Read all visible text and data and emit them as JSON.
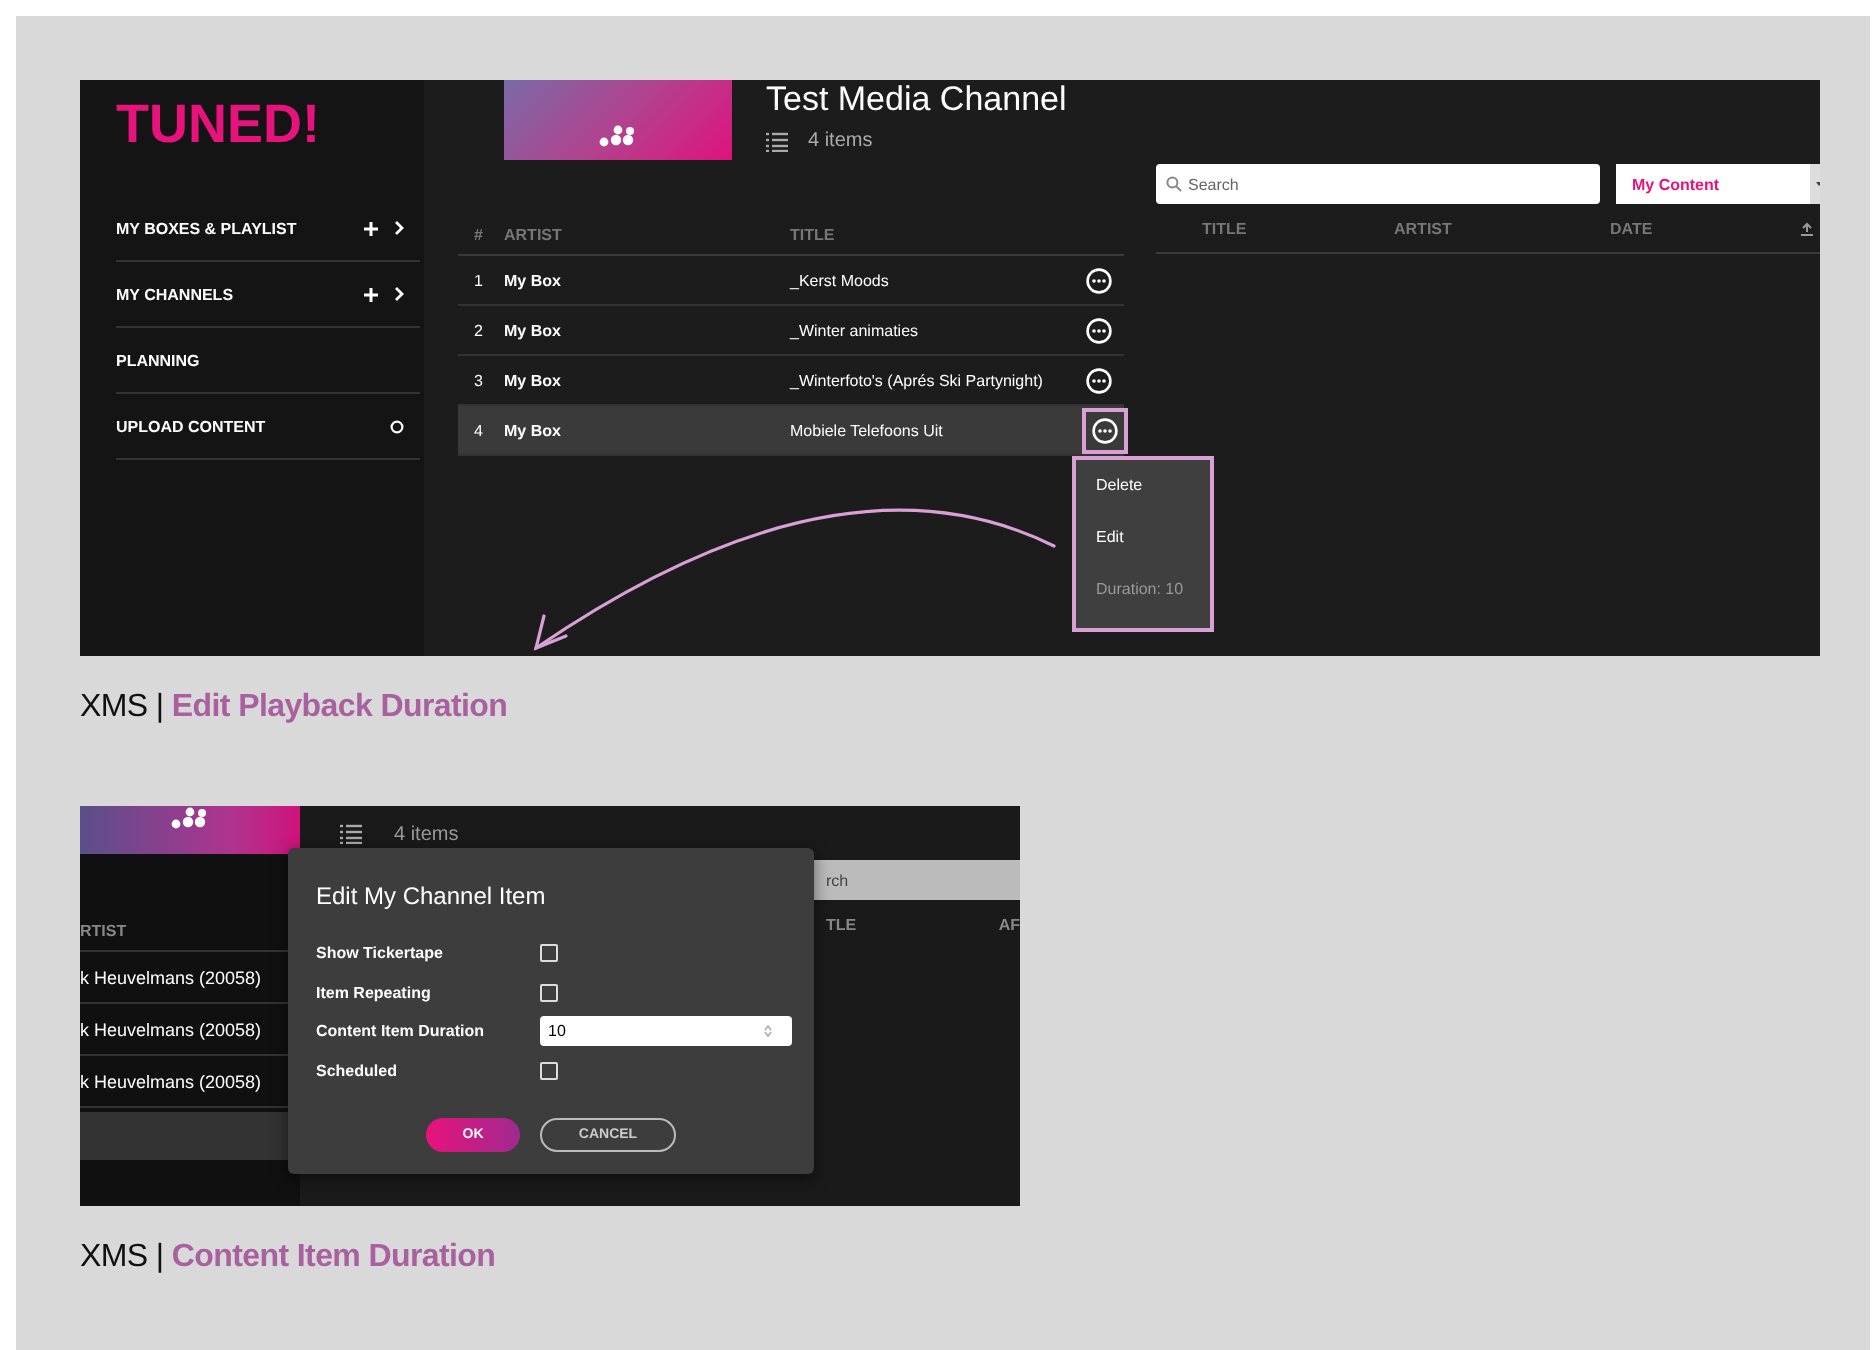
{
  "channel_screen": {
    "logo": "TUNED!",
    "sidebar": [
      {
        "label": "MY BOXES & PLAYLIST",
        "kind": "expandable"
      },
      {
        "label": "MY CHANNELS",
        "kind": "expandable"
      },
      {
        "label": "PLANNING",
        "kind": "plain"
      },
      {
        "label": "UPLOAD CONTENT",
        "kind": "loading"
      }
    ],
    "channel": {
      "title": "Test Media Channel",
      "items_count": "4 items"
    },
    "table": {
      "columns": [
        "#",
        "ARTIST",
        "TITLE"
      ],
      "rows": [
        {
          "number": "1",
          "artist": "My Box",
          "title": "_Kerst Moods",
          "selected": false,
          "highlighted": false
        },
        {
          "number": "2",
          "artist": "My Box",
          "title": "_Winter animaties",
          "selected": false,
          "highlighted": false
        },
        {
          "number": "3",
          "artist": "My Box",
          "title": "_Winterfoto's (Aprés Ski Partynight)",
          "selected": false,
          "highlighted": false
        },
        {
          "number": "4",
          "artist": "My Box",
          "title": "Mobiele Telefoons Uit",
          "selected": true,
          "highlighted": true
        }
      ]
    },
    "context_menu": [
      {
        "label": "Delete",
        "disabled": false
      },
      {
        "label": "Edit",
        "disabled": false
      },
      {
        "label": "Duration: 10",
        "disabled": true
      }
    ],
    "library": {
      "search": {
        "placeholder": "Search"
      },
      "filter": "My Content",
      "columns": [
        "TITLE",
        "ARTIST",
        "DATE"
      ]
    }
  },
  "caption_1": "XMS | **Edit Playback Duration**",
  "dialog_screen": {
    "items_count": "4 items",
    "left_column": "RTIST",
    "left_rows": [
      "k Heuvelmans (20058)",
      "k Heuvelmans (20058)",
      "k Heuvelmans (20058)"
    ],
    "search_text": "rch",
    "right_columns": [
      "TLE",
      "AF"
    ],
    "dialog": {
      "title": "Edit My Channel Item",
      "fields": [
        {
          "label": "Show Tickertape",
          "kind": "checkbox",
          "checked": false
        },
        {
          "label": "Item Repeating",
          "kind": "checkbox",
          "checked": false
        },
        {
          "label": "Content Item Duration",
          "kind": "number",
          "value": "10"
        },
        {
          "label": "Scheduled",
          "kind": "checkbox",
          "checked": false
        }
      ],
      "buttons": [
        {
          "label": "OK",
          "kind": "primary"
        },
        {
          "label": "CANCEL",
          "kind": "secondary"
        }
      ]
    }
  },
  "caption_2": "XMS | **Content Item Duration**"
}
